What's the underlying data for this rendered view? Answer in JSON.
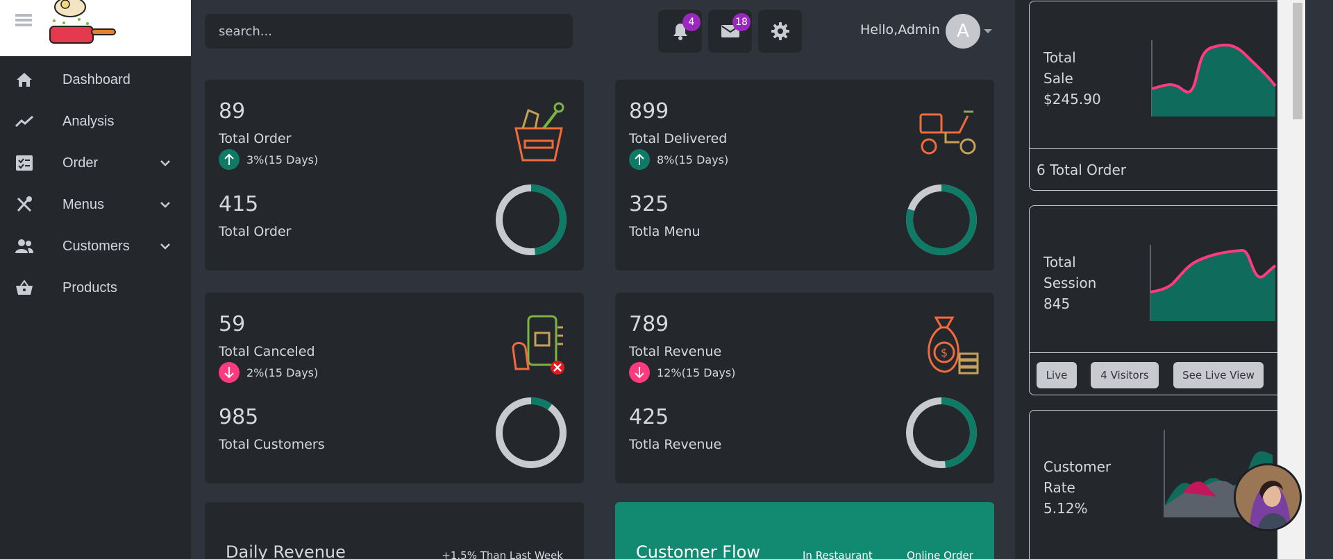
{
  "sidebar": {
    "items": [
      {
        "label": "Dashboard",
        "icon": "home-icon",
        "has_submenu": false
      },
      {
        "label": "Analysis",
        "icon": "trend-line-icon",
        "has_submenu": false
      },
      {
        "label": "Order",
        "icon": "order-check-icon",
        "has_submenu": true
      },
      {
        "label": "Menus",
        "icon": "utensils-icon",
        "has_submenu": true
      },
      {
        "label": "Customers",
        "icon": "users-icon",
        "has_submenu": true
      },
      {
        "label": "Products",
        "icon": "basket-icon",
        "has_submenu": false
      }
    ]
  },
  "header": {
    "search_placeholder": "search...",
    "notifications_count": "4",
    "messages_count": "18",
    "greeting": "Hello,Admin",
    "avatar_letter": "A"
  },
  "cards": [
    {
      "value": "89",
      "label": "Total Order",
      "trend": "3%(15 Days)",
      "trend_dir": "up",
      "value2": "415",
      "label2": "Total Order",
      "donut_fraction": 0.48
    },
    {
      "value": "899",
      "label": "Total Delivered",
      "trend": "8%(15 Days)",
      "trend_dir": "up",
      "value2": "325",
      "label2": "Totla Menu",
      "donut_fraction": 0.8
    },
    {
      "value": "59",
      "label": "Total Canceled",
      "trend": "2%(15 Days)",
      "trend_dir": "down",
      "value2": "985",
      "label2": "Total Customers",
      "donut_fraction": 0.1
    },
    {
      "value": "789",
      "label": "Total Revenue",
      "trend": "12%(15 Days)",
      "trend_dir": "down",
      "value2": "425",
      "label2": "Totla Revenue",
      "donut_fraction": 0.48
    }
  ],
  "bottom": {
    "daily_revenue_title": "Daily Revenue",
    "daily_revenue_sub": "+1.5% Than Last Week",
    "customer_flow_title": "Customer Flow",
    "in_restaurant": "In Restaurant",
    "online_order": "Online Order"
  },
  "right_panel": {
    "sale": {
      "line1": "Total",
      "line2": "Sale",
      "value": "$245.90",
      "footer": "6 Total Order"
    },
    "session": {
      "line1": "Total",
      "line2": "Session",
      "value": "845",
      "btn_live": "Live",
      "btn_visitors": "4 Visitors",
      "btn_live_view": "See Live View"
    },
    "customer_rate": {
      "line1": "Customer",
      "line2": "Rate",
      "value": "5.12%"
    }
  },
  "colors": {
    "accent_green": "#0f7b67",
    "accent_pink": "#ff3b7f",
    "purple_badge": "#9b27c0",
    "donut_gray": "#c8cad0",
    "icon_orange": "#f26b3a"
  }
}
